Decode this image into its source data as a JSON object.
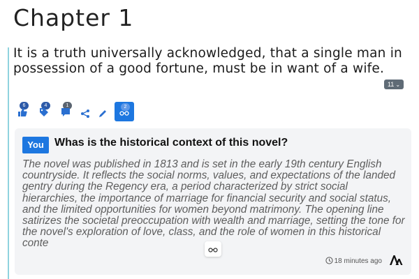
{
  "chapter": {
    "title": "Chapter 1"
  },
  "passage": {
    "text": "It is a truth universally acknowledged, that a single man in possession of a good fortune, must be in want of a wife.",
    "count": "11"
  },
  "toolbar": {
    "items": [
      {
        "name": "like",
        "icon": "thumbs-up-icon",
        "count": "6"
      },
      {
        "name": "tag",
        "icon": "tag-icon",
        "count": "4"
      },
      {
        "name": "comment",
        "icon": "comment-icon",
        "count": "1"
      },
      {
        "name": "share",
        "icon": "share-icon",
        "count": ""
      },
      {
        "name": "edit",
        "icon": "pencil-icon",
        "count": ""
      },
      {
        "name": "ai-reading",
        "icon": "glasses-icon",
        "count": "2"
      }
    ]
  },
  "conversation": {
    "user_label": "You",
    "question": "Whas is the historical context of this novel?",
    "answer": "The novel was published in 1813 and is set in the early 19th century English countryside. It reflects the social norms, values, and expectations of the landed gentry during the Regency era, a period characterized by strict social hierarchies, the importance of marriage for financial security and social status, and the limited opportunities for women beyond matrimony. The opening line satirizes the societal preoccupation with wealth and marriage, setting the tone for the novel's exploration of love, class, and the role of women in this historical conte",
    "timestamp": "18 minutes ago",
    "accent": "#1d77e0"
  }
}
